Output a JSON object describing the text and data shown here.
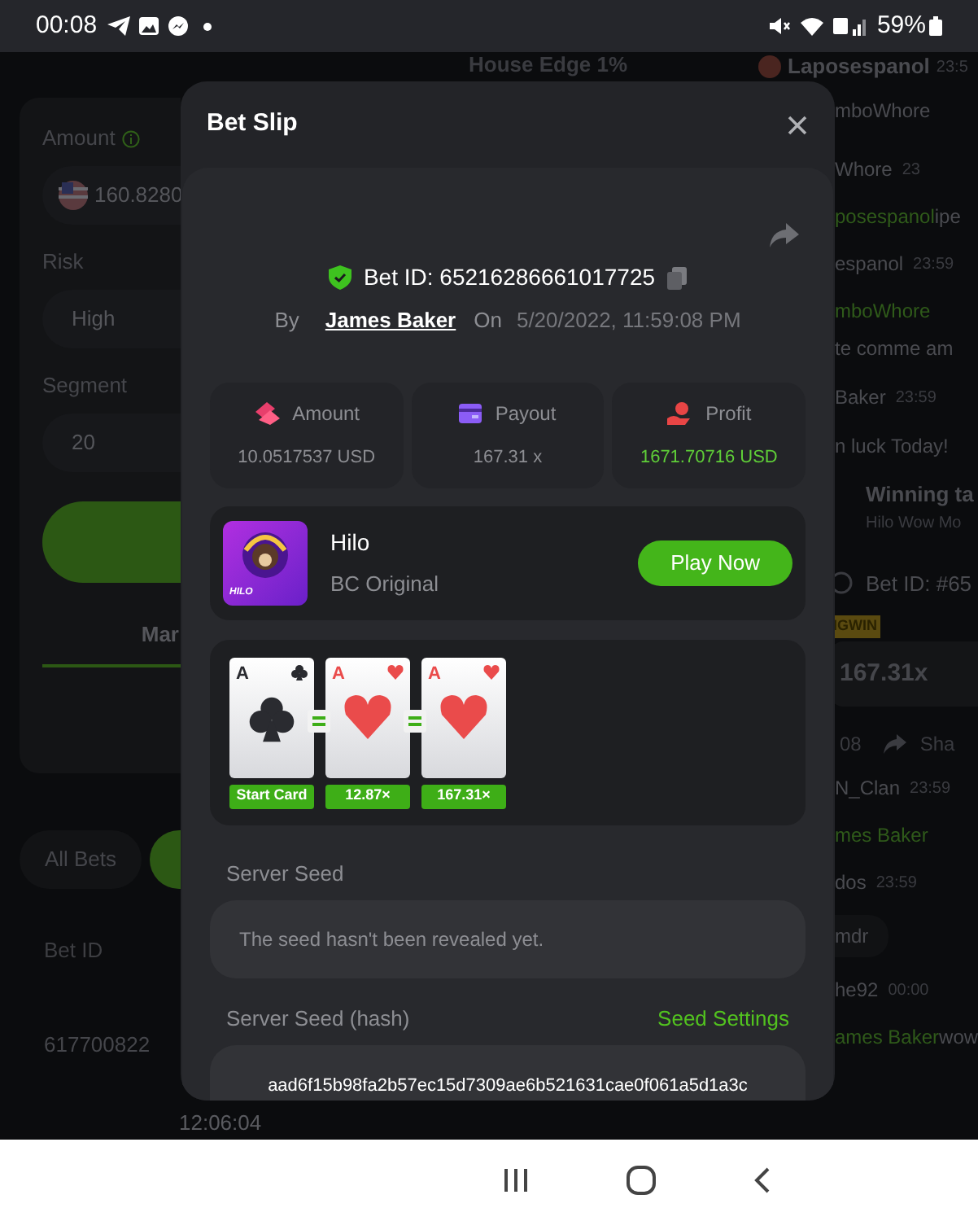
{
  "status_bar": {
    "time": "00:08",
    "battery": "59%"
  },
  "background": {
    "house_edge": "House Edge 1%",
    "form": [
      {
        "label": "Amount",
        "value": "160.8280",
        "kind": "amount"
      },
      {
        "label": "Risk",
        "value": "High",
        "kind": "select"
      },
      {
        "label": "Segment",
        "value": "20",
        "kind": "select"
      }
    ],
    "tab": "Mar",
    "bets_filter": "All Bets",
    "column_header": "Bet ID",
    "bet_id_cell": "617700822",
    "time_cell": "12:06:04",
    "chat": [
      {
        "kind": "header",
        "name": "Laposespanol",
        "time": "23:5"
      },
      {
        "kind": "name",
        "name": "mboWhore"
      },
      {
        "kind": "name",
        "name": "Whore",
        "time": "23"
      },
      {
        "kind": "mention",
        "name": "posespanol",
        "text": " ipe"
      },
      {
        "kind": "name",
        "name": "espanol",
        "time": "23:59"
      },
      {
        "kind": "mention",
        "name": "mboWhore"
      },
      {
        "kind": "message",
        "text": "te comme am"
      },
      {
        "kind": "name",
        "name": "Baker",
        "time": "23:59"
      },
      {
        "kind": "message",
        "text": "n luck Today!"
      },
      {
        "kind": "share",
        "name": "Winning ta",
        "text": "Hilo Wow Mo",
        "bet": "Bet ID: #65",
        "badge": "IGWIN",
        "multiplier": "167.31x",
        "time": "08",
        "action": "Sha"
      },
      {
        "kind": "name",
        "name": "N_Clan",
        "time": "23:59"
      },
      {
        "kind": "mention",
        "name": "mes Baker"
      },
      {
        "kind": "name",
        "name": "dos",
        "time": "23:59"
      },
      {
        "kind": "bubble",
        "text": "mdr"
      },
      {
        "kind": "name",
        "name": "he92",
        "time": "00:00"
      },
      {
        "kind": "mention",
        "name": "ames Baker",
        "text": " wow"
      }
    ]
  },
  "bet_slip": {
    "title": "Bet Slip",
    "bet_id": "Bet ID: 65216286661017725",
    "by_label": "By",
    "user": "James Baker",
    "on_label": "On",
    "date": "5/20/2022, 11:59:08 PM",
    "stats": [
      {
        "kind": "amount",
        "label": "Amount",
        "value": "10.0517537 USD"
      },
      {
        "kind": "payout",
        "label": "Payout",
        "value": "167.31 x"
      },
      {
        "kind": "profit",
        "label": "Profit",
        "value": "1671.70716 USD"
      }
    ],
    "game": {
      "logo_text": "HILO",
      "name": "Hilo",
      "provider": "BC Original",
      "button": "Play Now"
    },
    "cards": [
      {
        "rank": "A",
        "kind": "club",
        "label": "Start Card"
      },
      {
        "rank": "A",
        "kind": "heart",
        "label": "12.87×"
      },
      {
        "rank": "A",
        "kind": "heart",
        "label": "167.31×"
      }
    ],
    "server_seed": {
      "label": "Server Seed",
      "placeholder": "The seed hasn't been revealed yet."
    },
    "hash": {
      "label": "Server Seed (hash)",
      "link": "Seed Settings",
      "value": "aad6f15b98fa2b57ec15d7309ae6b521631cae0f061a5d1a3c"
    }
  }
}
